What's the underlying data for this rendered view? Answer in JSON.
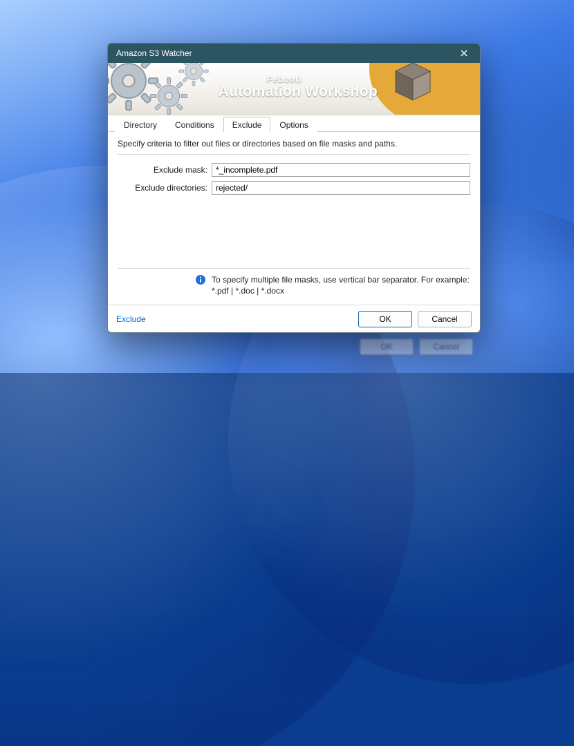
{
  "window": {
    "title": "Amazon S3 Watcher"
  },
  "banner": {
    "brand_small": "Febooti",
    "brand_big": "Automation Workshop"
  },
  "tabs": {
    "items": [
      {
        "label": "Directory"
      },
      {
        "label": "Conditions"
      },
      {
        "label": "Exclude"
      },
      {
        "label": "Options"
      }
    ],
    "active_index": 2
  },
  "exclude": {
    "instruction": "Specify criteria to filter out files or directories based on file masks and paths.",
    "mask_label": "Exclude mask:",
    "mask_value": "*_incomplete.pdf",
    "dirs_label": "Exclude directories:",
    "dirs_value": "rejected/",
    "hint_line1": "To specify multiple file masks, use vertical bar separator. For example:",
    "hint_line2": "*.pdf  |  *.doc  |  *.docx"
  },
  "footer": {
    "help_link": "Exclude",
    "ok": "OK",
    "cancel": "Cancel"
  },
  "ghost": {
    "ok": "OK",
    "cancel": "Cancel"
  }
}
